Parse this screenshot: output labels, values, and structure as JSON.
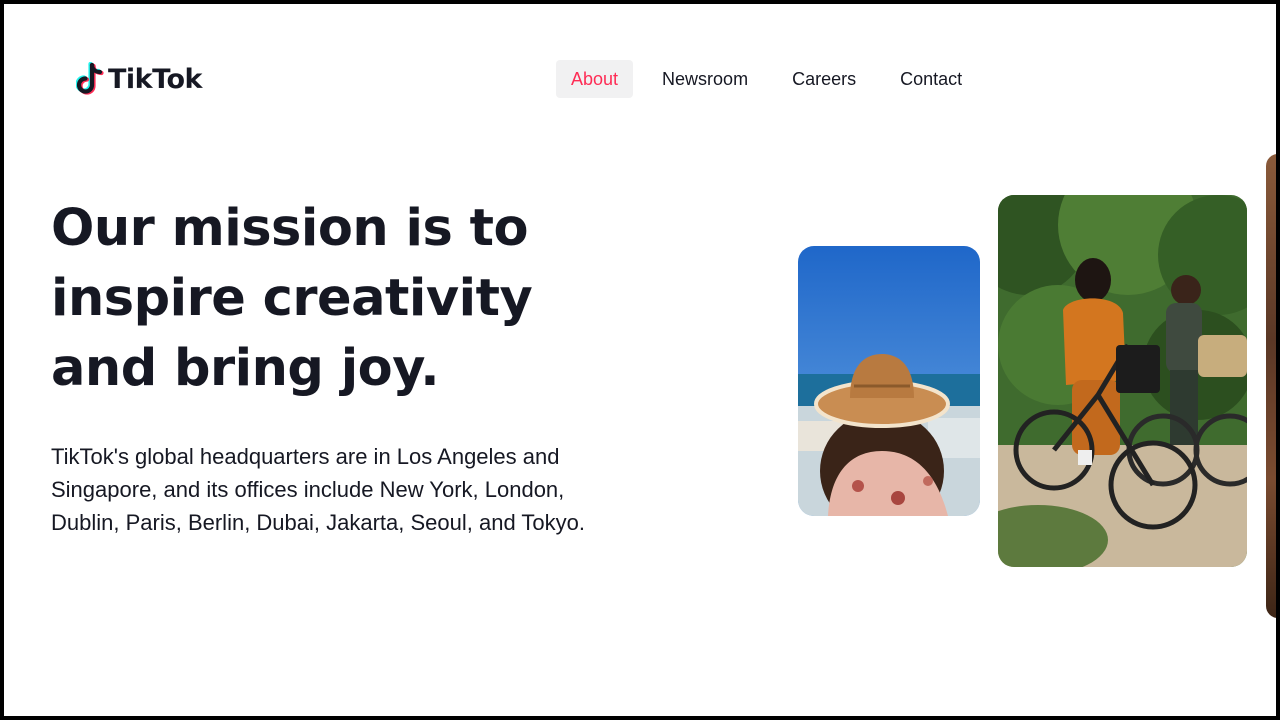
{
  "header": {
    "logo_text": "TikTok",
    "nav": [
      {
        "label": "About",
        "active": true
      },
      {
        "label": "Newsroom",
        "active": false
      },
      {
        "label": "Careers",
        "active": false
      },
      {
        "label": "Contact",
        "active": false
      }
    ]
  },
  "hero": {
    "headline": "Our mission is to inspire creativity and bring joy.",
    "description": "TikTok's global headquarters are in Los Angeles and Singapore, and its offices include New York, London, Dublin, Paris, Berlin, Dubai, Jakarta, Seoul, and Tokyo."
  },
  "colors": {
    "accent": "#fe2c55",
    "text": "#161823",
    "active_bg": "#f1f1f2",
    "logo_cyan": "#25f4ee"
  },
  "icons": [
    "tiktok-note-icon"
  ]
}
